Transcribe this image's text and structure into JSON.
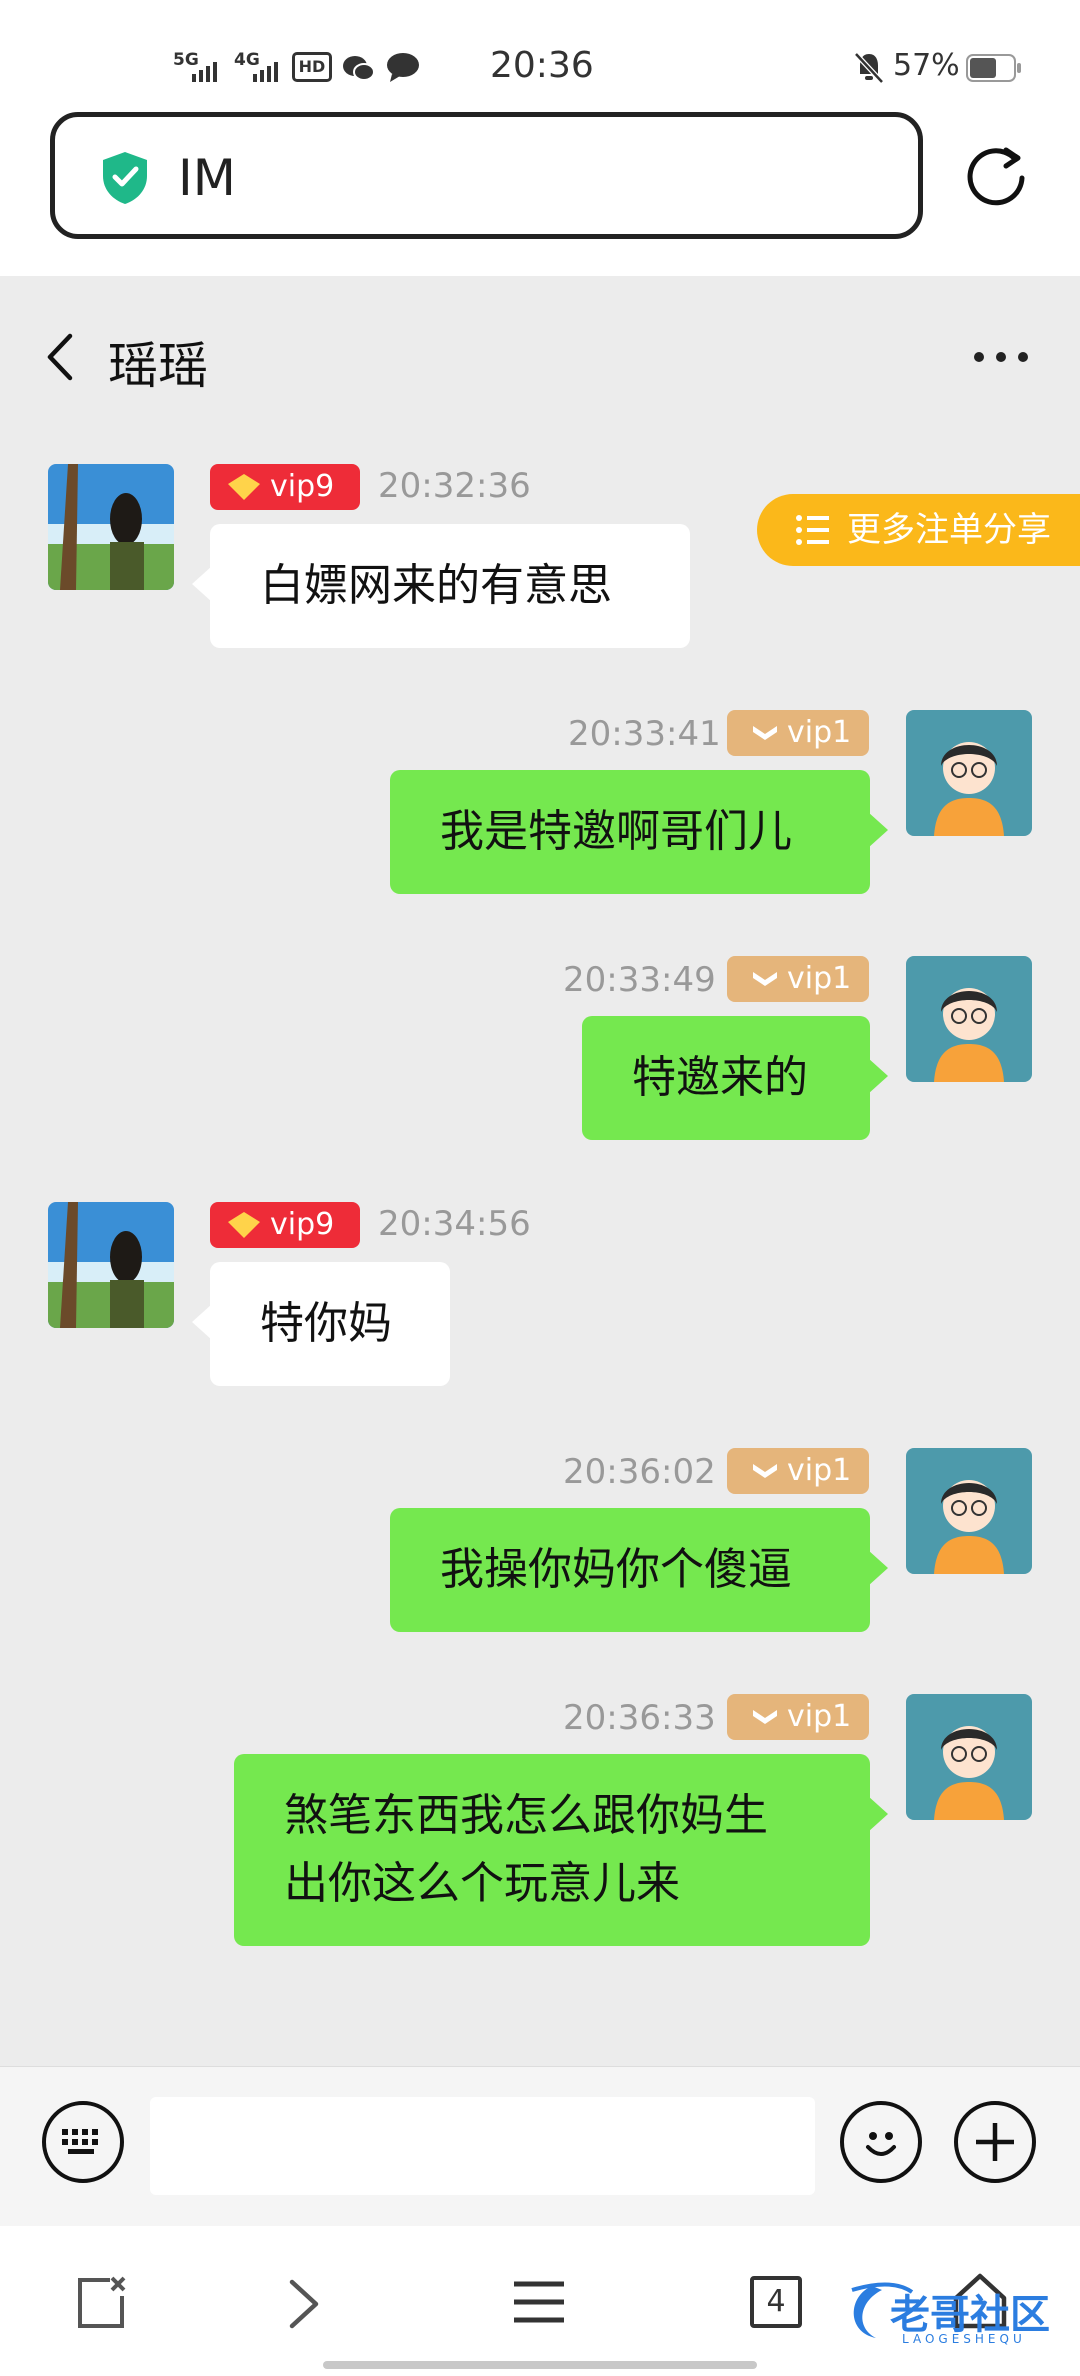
{
  "status_bar": {
    "network1": "5G",
    "network2": "4G",
    "hd": "HD",
    "time": "20:36",
    "battery": "57%"
  },
  "browser": {
    "url": "IM"
  },
  "chat": {
    "title": "瑶瑶",
    "share_button": "更多注单分享",
    "messages": [
      {
        "side": "left",
        "vip": "vip9",
        "time": "20:32:36",
        "text": "白嫖网来的有意思"
      },
      {
        "side": "right",
        "vip": "vip1",
        "time": "20:33:41",
        "text": "我是特邀啊哥们儿"
      },
      {
        "side": "right",
        "vip": "vip1",
        "time": "20:33:49",
        "text": "特邀来的"
      },
      {
        "side": "left",
        "vip": "vip9",
        "time": "20:34:56",
        "text": "特你妈"
      },
      {
        "side": "right",
        "vip": "vip1",
        "time": "20:36:02",
        "text": "我操你妈你个傻逼"
      },
      {
        "side": "right",
        "vip": "vip1",
        "time": "20:36:33",
        "line1": "煞笔东西我怎么跟你妈生",
        "line2": "出你这么个玩意儿来"
      }
    ]
  },
  "input": {
    "placeholder": ""
  },
  "nav": {
    "tabs_count": "4"
  },
  "watermark": {
    "text": "老哥社区",
    "sub": "LAOGESHEQU"
  },
  "colors": {
    "vip9": "#ee2c38",
    "vip1": "#e5b57b",
    "own_bubble": "#75e84f",
    "share": "#fbb81a",
    "shield": "#1fb889"
  }
}
